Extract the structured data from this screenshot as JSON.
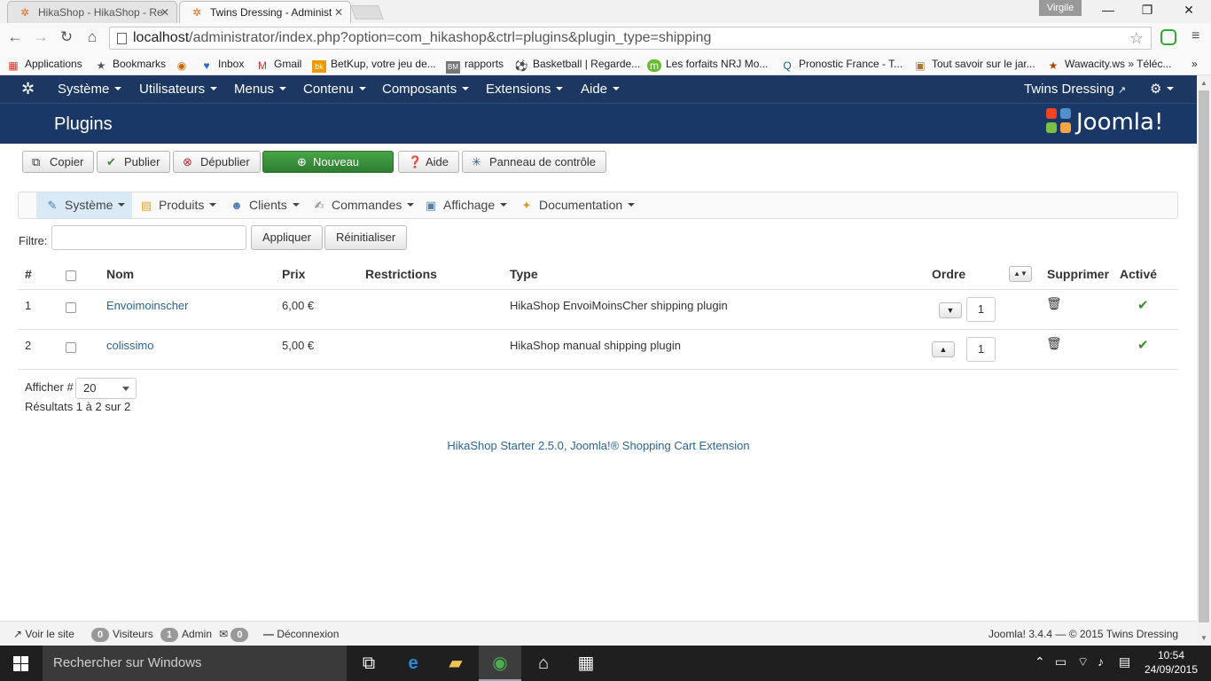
{
  "browser": {
    "tabs": [
      {
        "label": "HikaShop - HikaShop - Re",
        "active": false
      },
      {
        "label": "Twins Dressing - Administ",
        "active": true
      }
    ],
    "user_badge": "Virgile",
    "url_host": "localhost",
    "url_path": "/administrator/index.php?option=com_hikashop&ctrl=plugins&plugin_type=shipping",
    "bookmarks": [
      {
        "label": "Applications",
        "icon": "apps-grid-icon"
      },
      {
        "label": "Bookmarks",
        "icon": "star-icon"
      },
      {
        "label": "",
        "icon": "site-icon"
      },
      {
        "label": "Inbox",
        "icon": "inbox-icon"
      },
      {
        "label": "Gmail",
        "icon": "gmail-icon"
      },
      {
        "label": "BetKup, votre jeu de...",
        "icon": "betkup-icon"
      },
      {
        "label": "rapports",
        "icon": "rapports-icon"
      },
      {
        "label": "Basketball | Regarde...",
        "icon": "basketball-icon"
      },
      {
        "label": "Les forfaits NRJ Mo...",
        "icon": "nrj-icon"
      },
      {
        "label": "Pronostic France - T...",
        "icon": "pronostic-icon"
      },
      {
        "label": "Tout savoir sur le jar...",
        "icon": "jardin-icon"
      },
      {
        "label": "Wawacity.ws » Téléc...",
        "icon": "wawacity-icon"
      }
    ]
  },
  "joomla_nav": {
    "items": [
      "Système",
      "Utilisateurs",
      "Menus",
      "Contenu",
      "Composants",
      "Extensions",
      "Aide"
    ],
    "site_name": "Twins Dressing"
  },
  "header": {
    "title": "Plugins",
    "logo_text": "Joomla!"
  },
  "toolbar": {
    "copy": "Copier",
    "publish": "Publier",
    "unpublish": "Dépublier",
    "new": "Nouveau",
    "help": "Aide",
    "control_panel": "Panneau de contrôle"
  },
  "hika_menu": [
    "Système",
    "Produits",
    "Clients",
    "Commandes",
    "Affichage",
    "Documentation"
  ],
  "filter": {
    "label": "Filtre:",
    "value": "",
    "apply": "Appliquer",
    "reset": "Réinitialiser"
  },
  "table": {
    "headers": {
      "num": "#",
      "name": "Nom",
      "price": "Prix",
      "restrictions": "Restrictions",
      "type": "Type",
      "order": "Ordre",
      "delete": "Supprimer",
      "active": "Activé"
    },
    "rows": [
      {
        "num": "1",
        "name": "Envoimoinscher",
        "price": "6,00 €",
        "restrictions": "",
        "type": "HikaShop EnvoiMoinsCher shipping plugin",
        "order": "1"
      },
      {
        "num": "2",
        "name": "colissimo",
        "price": "5,00 €",
        "restrictions": "",
        "type": "HikaShop manual shipping plugin",
        "order": "1"
      }
    ]
  },
  "pagination": {
    "label": "Afficher #",
    "value": "20",
    "results": "Résultats 1 à 2 sur 2"
  },
  "credit": "HikaShop Starter 2.5.0, Joomla!® Shopping Cart Extension",
  "status": {
    "view_site": "Voir le site",
    "visitors_count": "0",
    "visitors_label": "Visiteurs",
    "admin_count": "1",
    "admin_label": "Admin",
    "messages_count": "0",
    "logout": "Déconnexion",
    "version": "Joomla! 3.4.4 — © 2015 Twins Dressing"
  },
  "taskbar": {
    "search_placeholder": "Rechercher sur Windows",
    "time": "10:54",
    "date": "24/09/2015"
  }
}
